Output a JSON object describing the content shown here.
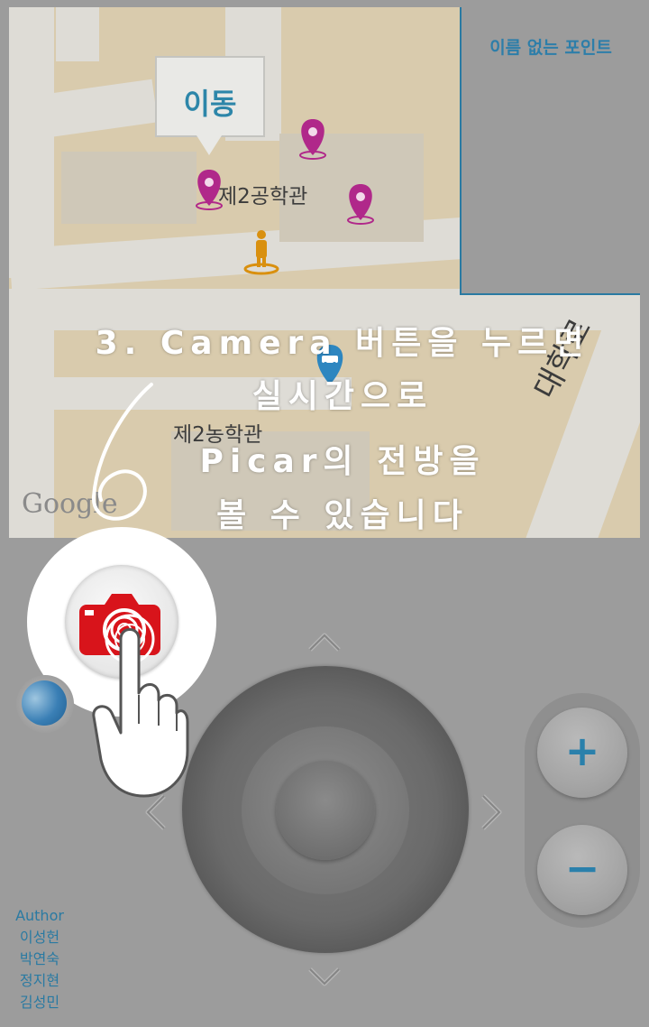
{
  "map": {
    "callout_text": "이동",
    "labels": {
      "building_engineering2": "제2공학관",
      "building_agriculture2": "제2농학관",
      "road_name": "대학로"
    },
    "attribution": "Google",
    "icons": [
      "map-pin-icon",
      "person-marker-icon",
      "car-marker-icon"
    ]
  },
  "info_panel": {
    "title": "이름 없는 포인트"
  },
  "instruction": {
    "line1": "3. Camera 버튼을 누르면",
    "line2": "실시간으로",
    "line3": "Picar의 전방을",
    "line4": "볼 수 있습니다"
  },
  "controls": {
    "camera_button_icon": "camera-icon",
    "zoom_in_label": "+",
    "zoom_out_label": "−",
    "direction_icons": [
      "chevron-up-icon",
      "chevron-down-icon",
      "chevron-left-icon",
      "chevron-right-icon"
    ]
  },
  "authors": {
    "heading": "Author",
    "names": [
      "이성헌",
      "박연숙",
      "정지현",
      "김성민"
    ]
  },
  "colors": {
    "accent_blue": "#2a7aa2",
    "pin_magenta": "#b0288a",
    "person_orange": "#d9900f",
    "camera_red": "#d8141b",
    "overlay_gray": "#9c9c9c"
  }
}
